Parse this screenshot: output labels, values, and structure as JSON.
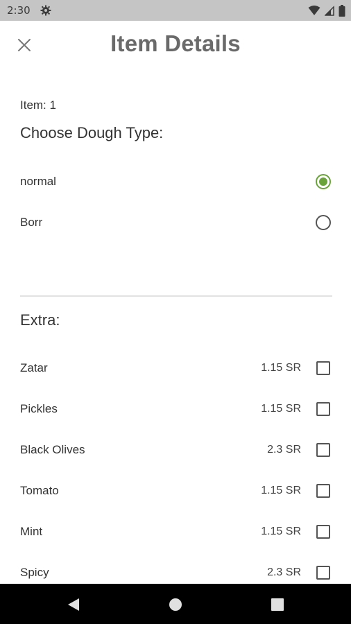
{
  "status_bar": {
    "time": "2:30"
  },
  "header": {
    "title": "Item Details"
  },
  "item": {
    "label": "Item: 1"
  },
  "dough": {
    "title": "Choose Dough Type:",
    "options": [
      {
        "label": "normal",
        "selected": true
      },
      {
        "label": "Borr",
        "selected": false
      }
    ]
  },
  "extra": {
    "title": "Extra:",
    "items": [
      {
        "label": "Zatar",
        "price": "1.15 SR",
        "checked": false
      },
      {
        "label": "Pickles",
        "price": "1.15 SR",
        "checked": false
      },
      {
        "label": "Black Olives",
        "price": "2.3 SR",
        "checked": false
      },
      {
        "label": "Tomato",
        "price": "1.15 SR",
        "checked": false
      },
      {
        "label": "Mint",
        "price": "1.15 SR",
        "checked": false
      },
      {
        "label": "Spicy",
        "price": "2.3 SR",
        "checked": false
      }
    ]
  },
  "colors": {
    "accent": "#6aa33a",
    "status_bar": "#c5c5c5",
    "nav_bar": "#000000"
  }
}
